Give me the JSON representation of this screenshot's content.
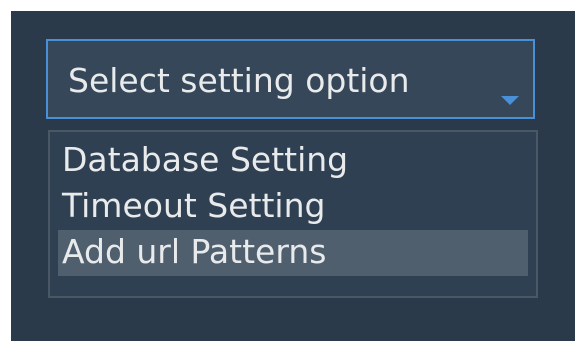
{
  "select": {
    "placeholder": "Select setting option",
    "icon": "chevron-down-icon",
    "accent_color": "#4a90d9"
  },
  "dropdown": {
    "options": [
      {
        "label": "Database Setting",
        "highlighted": false
      },
      {
        "label": "Timeout Setting",
        "highlighted": false
      },
      {
        "label": "Add url Patterns",
        "highlighted": true
      }
    ]
  }
}
